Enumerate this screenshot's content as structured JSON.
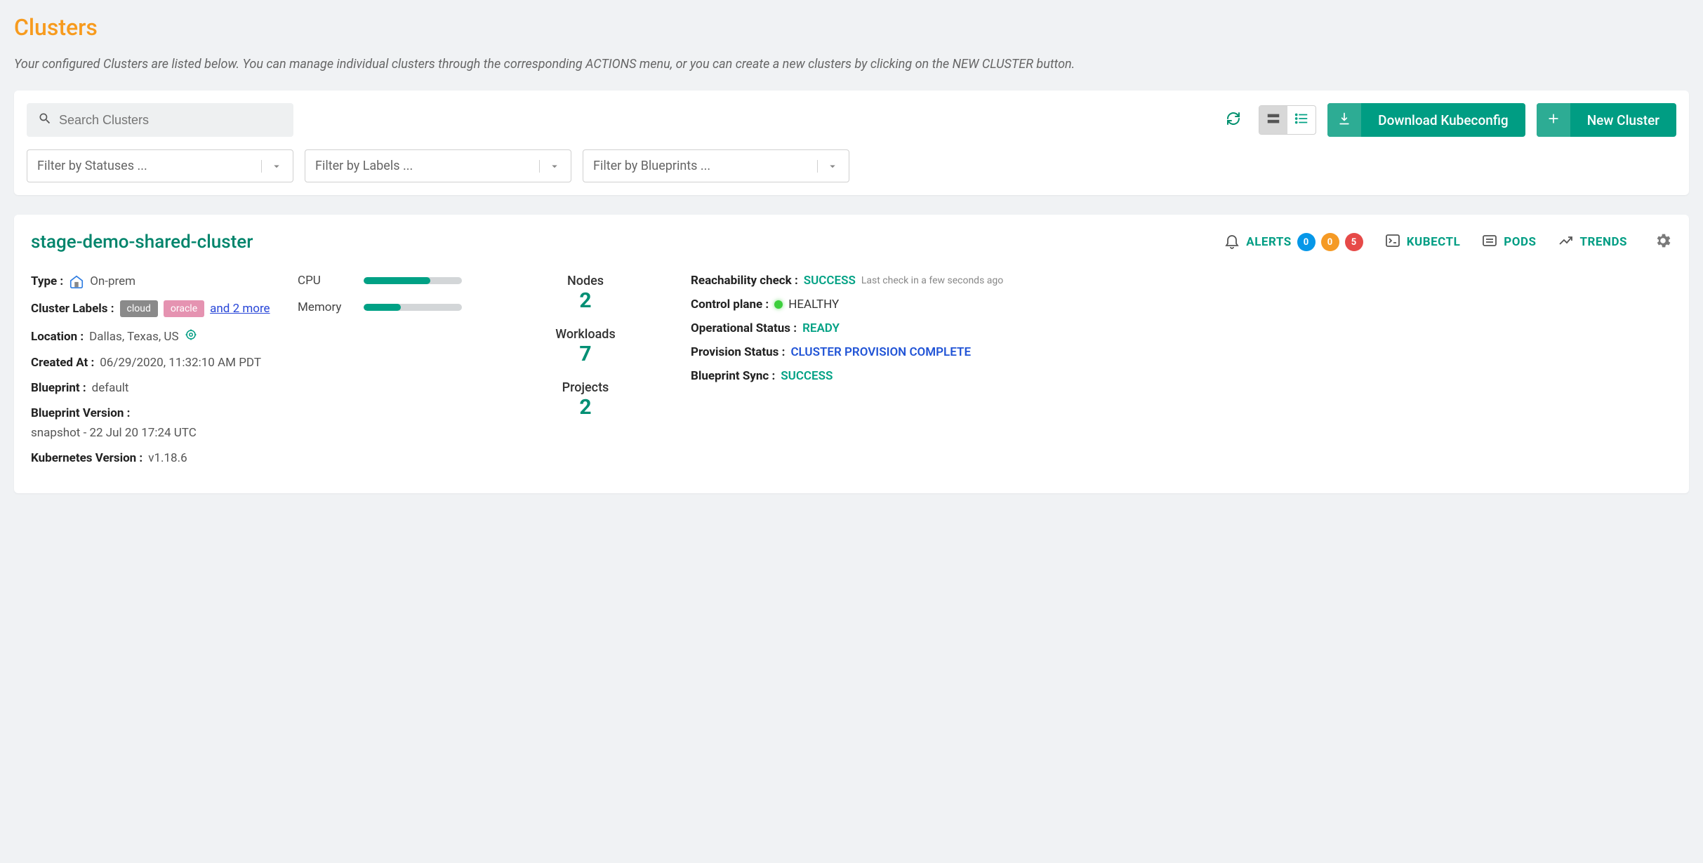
{
  "page": {
    "title": "Clusters",
    "description": "Your configured Clusters are listed below. You can manage individual clusters through the corresponding ACTIONS menu, or you can create a new clusters by clicking on the NEW CLUSTER button."
  },
  "toolbar": {
    "search_placeholder": "Search Clusters",
    "download_label": "Download Kubeconfig",
    "new_cluster_label": "New Cluster",
    "filter_status": "Filter by Statuses ...",
    "filter_labels": "Filter by Labels ...",
    "filter_blueprints": "Filter by Blueprints ..."
  },
  "cluster": {
    "name": "stage-demo-shared-cluster",
    "header_links": {
      "alerts": "ALERTS",
      "kubectl": "KUBECTL",
      "pods": "PODS",
      "trends": "TRENDS"
    },
    "alerts": {
      "info": "0",
      "warn": "0",
      "crit": "5"
    },
    "meta": {
      "type_k": "Type :",
      "type_v": "On-prem",
      "labels_k": "Cluster Labels :",
      "label1": "cloud",
      "label2": "oracle",
      "more_labels": "and 2 more",
      "location_k": "Location :",
      "location_v": "Dallas, Texas, US",
      "created_k": "Created At :",
      "created_v": "06/29/2020, 11:32:10 AM PDT",
      "blueprint_k": "Blueprint :",
      "blueprint_v": "default",
      "bpver_k": "Blueprint Version :",
      "bpver_v": "snapshot - 22 Jul 20 17:24 UTC",
      "k8s_k": "Kubernetes Version :",
      "k8s_v": "v1.18.6"
    },
    "resources": {
      "cpu_label": "CPU",
      "cpu_pct": 68,
      "mem_label": "Memory",
      "mem_pct": 38
    },
    "counts": {
      "nodes_k": "Nodes",
      "nodes_v": "2",
      "workloads_k": "Workloads",
      "workloads_v": "7",
      "projects_k": "Projects",
      "projects_v": "2"
    },
    "status": {
      "reach_k": "Reachability check :",
      "reach_v": "SUCCESS",
      "reach_note": "Last check in a few seconds ago",
      "cp_k": "Control plane :",
      "cp_v": "HEALTHY",
      "op_k": "Operational Status :",
      "op_v": "READY",
      "prov_k": "Provision Status :",
      "prov_v": "CLUSTER PROVISION COMPLETE",
      "sync_k": "Blueprint Sync :",
      "sync_v": "SUCCESS"
    }
  }
}
